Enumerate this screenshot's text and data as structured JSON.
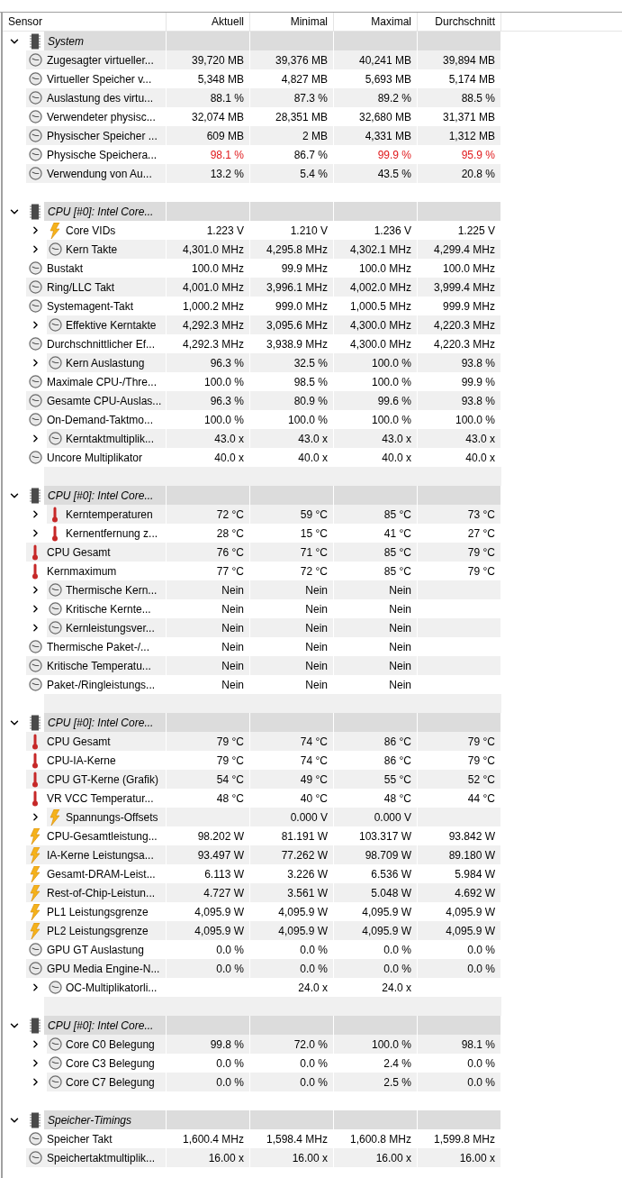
{
  "columns": [
    "Sensor",
    "Aktuell",
    "Minimal",
    "Maximal",
    "Durchschnitt"
  ],
  "groups": [
    {
      "name": "System",
      "expanded": true,
      "rows": [
        {
          "kind": "gauge",
          "expandable": false,
          "label": "Zugesagter virtueller...",
          "cells": {
            "aktuell": {
              "text": "39,720 MB",
              "warning": false
            },
            "minimal": {
              "text": "39,376 MB",
              "warning": false
            },
            "maximal": {
              "text": "40,241 MB",
              "warning": false
            },
            "durchschnitt": {
              "text": "39,894 MB",
              "warning": false
            }
          }
        },
        {
          "kind": "gauge",
          "expandable": false,
          "label": "Virtueller Speicher v...",
          "cells": {
            "aktuell": {
              "text": "5,348 MB",
              "warning": false
            },
            "minimal": {
              "text": "4,827 MB",
              "warning": false
            },
            "maximal": {
              "text": "5,693 MB",
              "warning": false
            },
            "durchschnitt": {
              "text": "5,174 MB",
              "warning": false
            }
          }
        },
        {
          "kind": "gauge",
          "expandable": false,
          "label": "Auslastung des virtu...",
          "cells": {
            "aktuell": {
              "text": "88.1 %",
              "warning": false
            },
            "minimal": {
              "text": "87.3 %",
              "warning": false
            },
            "maximal": {
              "text": "89.2 %",
              "warning": false
            },
            "durchschnitt": {
              "text": "88.5 %",
              "warning": false
            }
          }
        },
        {
          "kind": "gauge",
          "expandable": false,
          "label": "Verwendeter physisc...",
          "cells": {
            "aktuell": {
              "text": "32,074 MB",
              "warning": false
            },
            "minimal": {
              "text": "28,351 MB",
              "warning": false
            },
            "maximal": {
              "text": "32,680 MB",
              "warning": false
            },
            "durchschnitt": {
              "text": "31,371 MB",
              "warning": false
            }
          }
        },
        {
          "kind": "gauge",
          "expandable": false,
          "label": "Physischer Speicher ...",
          "cells": {
            "aktuell": {
              "text": "609 MB",
              "warning": false
            },
            "minimal": {
              "text": "2 MB",
              "warning": false
            },
            "maximal": {
              "text": "4,331 MB",
              "warning": false
            },
            "durchschnitt": {
              "text": "1,312 MB",
              "warning": false
            }
          }
        },
        {
          "kind": "gauge",
          "expandable": false,
          "label": "Physische Speichera...",
          "cells": {
            "aktuell": {
              "text": "98.1 %",
              "warning": true
            },
            "minimal": {
              "text": "86.7 %",
              "warning": false
            },
            "maximal": {
              "text": "99.9 %",
              "warning": true
            },
            "durchschnitt": {
              "text": "95.9 %",
              "warning": true
            }
          }
        },
        {
          "kind": "gauge",
          "expandable": false,
          "label": "Verwendung von Au...",
          "cells": {
            "aktuell": {
              "text": "13.2 %",
              "warning": false
            },
            "minimal": {
              "text": "5.4 %",
              "warning": false
            },
            "maximal": {
              "text": "43.5 %",
              "warning": false
            },
            "durchschnitt": {
              "text": "20.8 %",
              "warning": false
            }
          }
        }
      ]
    },
    {
      "name": "CPU [#0]: Intel Core...",
      "expanded": true,
      "rows": [
        {
          "kind": "bolt",
          "expandable": true,
          "label": "Core VIDs",
          "cells": {
            "aktuell": {
              "text": "1.223 V",
              "warning": false
            },
            "minimal": {
              "text": "1.210 V",
              "warning": false
            },
            "maximal": {
              "text": "1.236 V",
              "warning": false
            },
            "durchschnitt": {
              "text": "1.225 V",
              "warning": false
            }
          }
        },
        {
          "kind": "gauge",
          "expandable": true,
          "label": "Kern Takte",
          "cells": {
            "aktuell": {
              "text": "4,301.0 MHz",
              "warning": false
            },
            "minimal": {
              "text": "4,295.8 MHz",
              "warning": false
            },
            "maximal": {
              "text": "4,302.1 MHz",
              "warning": false
            },
            "durchschnitt": {
              "text": "4,299.4 MHz",
              "warning": false
            }
          }
        },
        {
          "kind": "gauge",
          "expandable": false,
          "label": "Bustakt",
          "cells": {
            "aktuell": {
              "text": "100.0 MHz",
              "warning": false
            },
            "minimal": {
              "text": "99.9 MHz",
              "warning": false
            },
            "maximal": {
              "text": "100.0 MHz",
              "warning": false
            },
            "durchschnitt": {
              "text": "100.0 MHz",
              "warning": false
            }
          }
        },
        {
          "kind": "gauge",
          "expandable": false,
          "label": "Ring/LLC Takt",
          "cells": {
            "aktuell": {
              "text": "4,001.0 MHz",
              "warning": false
            },
            "minimal": {
              "text": "3,996.1 MHz",
              "warning": false
            },
            "maximal": {
              "text": "4,002.0 MHz",
              "warning": false
            },
            "durchschnitt": {
              "text": "3,999.4 MHz",
              "warning": false
            }
          }
        },
        {
          "kind": "gauge",
          "expandable": false,
          "label": "Systemagent-Takt",
          "cells": {
            "aktuell": {
              "text": "1,000.2 MHz",
              "warning": false
            },
            "minimal": {
              "text": "999.0 MHz",
              "warning": false
            },
            "maximal": {
              "text": "1,000.5 MHz",
              "warning": false
            },
            "durchschnitt": {
              "text": "999.9 MHz",
              "warning": false
            }
          }
        },
        {
          "kind": "gauge",
          "expandable": true,
          "label": "Effektive Kerntakte",
          "cells": {
            "aktuell": {
              "text": "4,292.3 MHz",
              "warning": false
            },
            "minimal": {
              "text": "3,095.6 MHz",
              "warning": false
            },
            "maximal": {
              "text": "4,300.0 MHz",
              "warning": false
            },
            "durchschnitt": {
              "text": "4,220.3 MHz",
              "warning": false
            }
          }
        },
        {
          "kind": "gauge",
          "expandable": false,
          "label": "Durchschnittlicher Ef...",
          "cells": {
            "aktuell": {
              "text": "4,292.3 MHz",
              "warning": false
            },
            "minimal": {
              "text": "3,938.9 MHz",
              "warning": false
            },
            "maximal": {
              "text": "4,300.0 MHz",
              "warning": false
            },
            "durchschnitt": {
              "text": "4,220.3 MHz",
              "warning": false
            }
          }
        },
        {
          "kind": "gauge",
          "expandable": true,
          "label": "Kern Auslastung",
          "cells": {
            "aktuell": {
              "text": "96.3 %",
              "warning": false
            },
            "minimal": {
              "text": "32.5 %",
              "warning": false
            },
            "maximal": {
              "text": "100.0 %",
              "warning": false
            },
            "durchschnitt": {
              "text": "93.8 %",
              "warning": false
            }
          }
        },
        {
          "kind": "gauge",
          "expandable": false,
          "label": "Maximale CPU-/Thre...",
          "cells": {
            "aktuell": {
              "text": "100.0 %",
              "warning": false
            },
            "minimal": {
              "text": "98.5 %",
              "warning": false
            },
            "maximal": {
              "text": "100.0 %",
              "warning": false
            },
            "durchschnitt": {
              "text": "99.9 %",
              "warning": false
            }
          }
        },
        {
          "kind": "gauge",
          "expandable": false,
          "label": "Gesamte CPU-Auslas...",
          "cells": {
            "aktuell": {
              "text": "96.3 %",
              "warning": false
            },
            "minimal": {
              "text": "80.9 %",
              "warning": false
            },
            "maximal": {
              "text": "99.6 %",
              "warning": false
            },
            "durchschnitt": {
              "text": "93.8 %",
              "warning": false
            }
          }
        },
        {
          "kind": "gauge",
          "expandable": false,
          "label": "On-Demand-Taktmo...",
          "cells": {
            "aktuell": {
              "text": "100.0 %",
              "warning": false
            },
            "minimal": {
              "text": "100.0 %",
              "warning": false
            },
            "maximal": {
              "text": "100.0 %",
              "warning": false
            },
            "durchschnitt": {
              "text": "100.0 %",
              "warning": false
            }
          }
        },
        {
          "kind": "gauge",
          "expandable": true,
          "label": "Kerntaktmultiplik...",
          "cells": {
            "aktuell": {
              "text": "43.0 x",
              "warning": false
            },
            "minimal": {
              "text": "43.0 x",
              "warning": false
            },
            "maximal": {
              "text": "43.0 x",
              "warning": false
            },
            "durchschnitt": {
              "text": "43.0 x",
              "warning": false
            }
          }
        },
        {
          "kind": "gauge",
          "expandable": false,
          "label": "Uncore Multiplikator",
          "cells": {
            "aktuell": {
              "text": "40.0 x",
              "warning": false
            },
            "minimal": {
              "text": "40.0 x",
              "warning": false
            },
            "maximal": {
              "text": "40.0 x",
              "warning": false
            },
            "durchschnitt": {
              "text": "40.0 x",
              "warning": false
            }
          }
        }
      ]
    },
    {
      "name": "CPU [#0]: Intel Core...",
      "expanded": true,
      "rows": [
        {
          "kind": "thermometer",
          "expandable": true,
          "label": "Kerntemperaturen",
          "cells": {
            "aktuell": {
              "text": "72 °C",
              "warning": false
            },
            "minimal": {
              "text": "59 °C",
              "warning": false
            },
            "maximal": {
              "text": "85 °C",
              "warning": false
            },
            "durchschnitt": {
              "text": "73 °C",
              "warning": false
            }
          }
        },
        {
          "kind": "thermometer",
          "expandable": true,
          "label": "Kernentfernung z...",
          "cells": {
            "aktuell": {
              "text": "28 °C",
              "warning": false
            },
            "minimal": {
              "text": "15 °C",
              "warning": false
            },
            "maximal": {
              "text": "41 °C",
              "warning": false
            },
            "durchschnitt": {
              "text": "27 °C",
              "warning": false
            }
          }
        },
        {
          "kind": "thermometer",
          "expandable": false,
          "label": "CPU Gesamt",
          "cells": {
            "aktuell": {
              "text": "76 °C",
              "warning": false
            },
            "minimal": {
              "text": "71 °C",
              "warning": false
            },
            "maximal": {
              "text": "85 °C",
              "warning": false
            },
            "durchschnitt": {
              "text": "79 °C",
              "warning": false
            }
          }
        },
        {
          "kind": "thermometer",
          "expandable": false,
          "label": "Kernmaximum",
          "cells": {
            "aktuell": {
              "text": "77 °C",
              "warning": false
            },
            "minimal": {
              "text": "72 °C",
              "warning": false
            },
            "maximal": {
              "text": "85 °C",
              "warning": false
            },
            "durchschnitt": {
              "text": "79 °C",
              "warning": false
            }
          }
        },
        {
          "kind": "gauge",
          "expandable": true,
          "label": "Thermische Kern...",
          "cells": {
            "aktuell": {
              "text": "Nein",
              "warning": false
            },
            "minimal": {
              "text": "Nein",
              "warning": false
            },
            "maximal": {
              "text": "Nein",
              "warning": false
            }
          }
        },
        {
          "kind": "gauge",
          "expandable": true,
          "label": "Kritische Kernte...",
          "cells": {
            "aktuell": {
              "text": "Nein",
              "warning": false
            },
            "minimal": {
              "text": "Nein",
              "warning": false
            },
            "maximal": {
              "text": "Nein",
              "warning": false
            }
          }
        },
        {
          "kind": "gauge",
          "expandable": true,
          "label": "Kernleistungsver...",
          "cells": {
            "aktuell": {
              "text": "Nein",
              "warning": false
            },
            "minimal": {
              "text": "Nein",
              "warning": false
            },
            "maximal": {
              "text": "Nein",
              "warning": false
            }
          }
        },
        {
          "kind": "gauge",
          "expandable": false,
          "label": "Thermische Paket-/...",
          "cells": {
            "aktuell": {
              "text": "Nein",
              "warning": false
            },
            "minimal": {
              "text": "Nein",
              "warning": false
            },
            "maximal": {
              "text": "Nein",
              "warning": false
            }
          }
        },
        {
          "kind": "gauge",
          "expandable": false,
          "label": "Kritische Temperatu...",
          "cells": {
            "aktuell": {
              "text": "Nein",
              "warning": false
            },
            "minimal": {
              "text": "Nein",
              "warning": false
            },
            "maximal": {
              "text": "Nein",
              "warning": false
            }
          }
        },
        {
          "kind": "gauge",
          "expandable": false,
          "label": "Paket-/Ringleistungs...",
          "cells": {
            "aktuell": {
              "text": "Nein",
              "warning": false
            },
            "minimal": {
              "text": "Nein",
              "warning": false
            },
            "maximal": {
              "text": "Nein",
              "warning": false
            }
          }
        }
      ]
    },
    {
      "name": "CPU [#0]: Intel Core...",
      "expanded": true,
      "rows": [
        {
          "kind": "thermometer",
          "expandable": false,
          "label": "CPU Gesamt",
          "cells": {
            "aktuell": {
              "text": "79 °C",
              "warning": false
            },
            "minimal": {
              "text": "74 °C",
              "warning": false
            },
            "maximal": {
              "text": "86 °C",
              "warning": false
            },
            "durchschnitt": {
              "text": "79 °C",
              "warning": false
            }
          }
        },
        {
          "kind": "thermometer",
          "expandable": false,
          "label": "CPU-IA-Kerne",
          "cells": {
            "aktuell": {
              "text": "79 °C",
              "warning": false
            },
            "minimal": {
              "text": "74 °C",
              "warning": false
            },
            "maximal": {
              "text": "86 °C",
              "warning": false
            },
            "durchschnitt": {
              "text": "79 °C",
              "warning": false
            }
          }
        },
        {
          "kind": "thermometer",
          "expandable": false,
          "label": "CPU GT-Kerne (Grafik)",
          "cells": {
            "aktuell": {
              "text": "54 °C",
              "warning": false
            },
            "minimal": {
              "text": "49 °C",
              "warning": false
            },
            "maximal": {
              "text": "55 °C",
              "warning": false
            },
            "durchschnitt": {
              "text": "52 °C",
              "warning": false
            }
          }
        },
        {
          "kind": "thermometer",
          "expandable": false,
          "label": "VR VCC Temperatur...",
          "cells": {
            "aktuell": {
              "text": "48 °C",
              "warning": false
            },
            "minimal": {
              "text": "40 °C",
              "warning": false
            },
            "maximal": {
              "text": "48 °C",
              "warning": false
            },
            "durchschnitt": {
              "text": "44 °C",
              "warning": false
            }
          }
        },
        {
          "kind": "bolt",
          "expandable": true,
          "label": "Spannungs-Offsets",
          "cells": {
            "minimal": {
              "text": "0.000 V",
              "warning": false
            },
            "maximal": {
              "text": "0.000 V",
              "warning": false
            }
          }
        },
        {
          "kind": "bolt",
          "expandable": false,
          "label": "CPU-Gesamtleistung...",
          "cells": {
            "aktuell": {
              "text": "98.202 W",
              "warning": false
            },
            "minimal": {
              "text": "81.191 W",
              "warning": false
            },
            "maximal": {
              "text": "103.317 W",
              "warning": false
            },
            "durchschnitt": {
              "text": "93.842 W",
              "warning": false
            }
          }
        },
        {
          "kind": "bolt",
          "expandable": false,
          "label": "IA-Kerne Leistungsa...",
          "cells": {
            "aktuell": {
              "text": "93.497 W",
              "warning": false
            },
            "minimal": {
              "text": "77.262 W",
              "warning": false
            },
            "maximal": {
              "text": "98.709 W",
              "warning": false
            },
            "durchschnitt": {
              "text": "89.180 W",
              "warning": false
            }
          }
        },
        {
          "kind": "bolt",
          "expandable": false,
          "label": "Gesamt-DRAM-Leist...",
          "cells": {
            "aktuell": {
              "text": "6.113 W",
              "warning": false
            },
            "minimal": {
              "text": "3.226 W",
              "warning": false
            },
            "maximal": {
              "text": "6.536 W",
              "warning": false
            },
            "durchschnitt": {
              "text": "5.984 W",
              "warning": false
            }
          }
        },
        {
          "kind": "bolt",
          "expandable": false,
          "label": "Rest-of-Chip-Leistun...",
          "cells": {
            "aktuell": {
              "text": "4.727 W",
              "warning": false
            },
            "minimal": {
              "text": "3.561 W",
              "warning": false
            },
            "maximal": {
              "text": "5.048 W",
              "warning": false
            },
            "durchschnitt": {
              "text": "4.692 W",
              "warning": false
            }
          }
        },
        {
          "kind": "bolt",
          "expandable": false,
          "label": "PL1 Leistungsgrenze",
          "cells": {
            "aktuell": {
              "text": "4,095.9 W",
              "warning": false
            },
            "minimal": {
              "text": "4,095.9 W",
              "warning": false
            },
            "maximal": {
              "text": "4,095.9 W",
              "warning": false
            },
            "durchschnitt": {
              "text": "4,095.9 W",
              "warning": false
            }
          }
        },
        {
          "kind": "bolt",
          "expandable": false,
          "label": "PL2 Leistungsgrenze",
          "cells": {
            "aktuell": {
              "text": "4,095.9 W",
              "warning": false
            },
            "minimal": {
              "text": "4,095.9 W",
              "warning": false
            },
            "maximal": {
              "text": "4,095.9 W",
              "warning": false
            },
            "durchschnitt": {
              "text": "4,095.9 W",
              "warning": false
            }
          }
        },
        {
          "kind": "gauge",
          "expandable": false,
          "label": "GPU GT Auslastung",
          "cells": {
            "aktuell": {
              "text": "0.0 %",
              "warning": false
            },
            "minimal": {
              "text": "0.0 %",
              "warning": false
            },
            "maximal": {
              "text": "0.0 %",
              "warning": false
            },
            "durchschnitt": {
              "text": "0.0 %",
              "warning": false
            }
          }
        },
        {
          "kind": "gauge",
          "expandable": false,
          "label": "GPU Media Engine-N...",
          "cells": {
            "aktuell": {
              "text": "0.0 %",
              "warning": false
            },
            "minimal": {
              "text": "0.0 %",
              "warning": false
            },
            "maximal": {
              "text": "0.0 %",
              "warning": false
            },
            "durchschnitt": {
              "text": "0.0 %",
              "warning": false
            }
          }
        },
        {
          "kind": "gauge",
          "expandable": true,
          "label": "OC-Multiplikatorli...",
          "cells": {
            "minimal": {
              "text": "24.0 x",
              "warning": false
            },
            "maximal": {
              "text": "24.0 x",
              "warning": false
            }
          }
        }
      ]
    },
    {
      "name": "CPU [#0]: Intel Core...",
      "expanded": true,
      "rows": [
        {
          "kind": "gauge",
          "expandable": true,
          "label": "Core C0 Belegung",
          "cells": {
            "aktuell": {
              "text": "99.8 %",
              "warning": false
            },
            "minimal": {
              "text": "72.0 %",
              "warning": false
            },
            "maximal": {
              "text": "100.0 %",
              "warning": false
            },
            "durchschnitt": {
              "text": "98.1 %",
              "warning": false
            }
          }
        },
        {
          "kind": "gauge",
          "expandable": true,
          "label": "Core C3 Belegung",
          "cells": {
            "aktuell": {
              "text": "0.0 %",
              "warning": false
            },
            "minimal": {
              "text": "0.0 %",
              "warning": false
            },
            "maximal": {
              "text": "2.4 %",
              "warning": false
            },
            "durchschnitt": {
              "text": "0.0 %",
              "warning": false
            }
          }
        },
        {
          "kind": "gauge",
          "expandable": true,
          "label": "Core C7 Belegung",
          "cells": {
            "aktuell": {
              "text": "0.0 %",
              "warning": false
            },
            "minimal": {
              "text": "0.0 %",
              "warning": false
            },
            "maximal": {
              "text": "2.5 %",
              "warning": false
            },
            "durchschnitt": {
              "text": "0.0 %",
              "warning": false
            }
          }
        }
      ]
    },
    {
      "name": "Speicher-Timings",
      "expanded": true,
      "rows": [
        {
          "kind": "gauge",
          "expandable": false,
          "label": "Speicher Takt",
          "cells": {
            "aktuell": {
              "text": "1,600.4 MHz",
              "warning": false
            },
            "minimal": {
              "text": "1,598.4 MHz",
              "warning": false
            },
            "maximal": {
              "text": "1,600.8 MHz",
              "warning": false
            },
            "durchschnitt": {
              "text": "1,599.8 MHz",
              "warning": false
            }
          }
        },
        {
          "kind": "gauge",
          "expandable": false,
          "label": "Speichertaktmultiplik...",
          "cells": {
            "aktuell": {
              "text": "16.00 x",
              "warning": false
            },
            "minimal": {
              "text": "16.00 x",
              "warning": false
            },
            "maximal": {
              "text": "16.00 x",
              "warning": false
            },
            "durchschnitt": {
              "text": "16.00 x",
              "warning": false
            }
          }
        }
      ]
    }
  ]
}
